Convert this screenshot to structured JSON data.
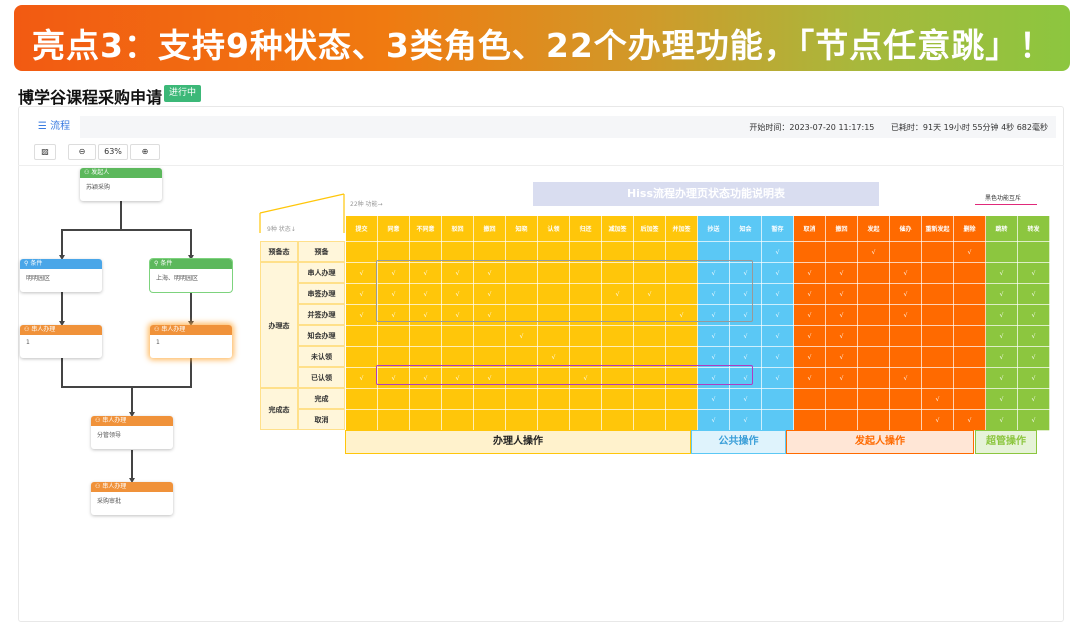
{
  "banner": {
    "text": "亮点3：支持9种状态、3类角色、22个办理功能，「节点任意跳」！"
  },
  "page": {
    "title": "博学谷课程采购申请",
    "status": "进行中"
  },
  "toolbar": {
    "tab": "流程",
    "start_label": "开始时间：",
    "start_value": "2023-07-20 11:17:15",
    "elapsed_label": "已耗时：",
    "elapsed_value": "91天 19小时 55分钟 4秒 682毫秒"
  },
  "zoom": {
    "value": "63%"
  },
  "nodes": [
    {
      "type": "发起人",
      "body": "苏颖采购",
      "color": "#5cb85c"
    },
    {
      "type": "条件",
      "body": "明明园区",
      "color": "#4aa6e8"
    },
    {
      "type": "条件",
      "body": "上海、明明园区",
      "color": "#5cb85c"
    },
    {
      "type": "串人办理",
      "body": "1",
      "color": "#f0923a"
    },
    {
      "type": "串人办理",
      "body": "1",
      "color": "#f0923a"
    },
    {
      "type": "串人办理",
      "body": "分管领导",
      "color": "#f0923a"
    },
    {
      "type": "串人办理",
      "body": "采购审批",
      "color": "#f0923a"
    }
  ],
  "matrix": {
    "title": "Hiss流程办理页状态功能说明表",
    "legend": "黑色功能互斥",
    "corner_top": "22种 功能→",
    "corner_bottom": "9种 状态↓",
    "columns": [
      "提交",
      "同意",
      "不同意",
      "驳回",
      "撤回",
      "知晓",
      "认领",
      "归还",
      "减加签",
      "后加签",
      "并加签",
      "抄送",
      "知会",
      "暂存",
      "取消",
      "撤回",
      "发起",
      "催办",
      "重新发起",
      "删除",
      "跳转",
      "转发"
    ],
    "groups": [
      {
        "label": "预备态",
        "rows": 1
      },
      {
        "label": "办理态",
        "rows": 6
      },
      {
        "label": "完成态",
        "rows": 2
      }
    ],
    "rows": [
      {
        "name": "预备",
        "checks": [
          13,
          16,
          19
        ]
      },
      {
        "name": "串人办理",
        "checks": [
          0,
          1,
          2,
          3,
          4,
          11,
          12,
          13,
          14,
          15,
          17,
          20,
          21
        ]
      },
      {
        "name": "串签办理",
        "checks": [
          0,
          1,
          2,
          3,
          4,
          8,
          9,
          11,
          12,
          13,
          14,
          15,
          17,
          20,
          21
        ]
      },
      {
        "name": "并签办理",
        "checks": [
          0,
          1,
          2,
          3,
          4,
          10,
          11,
          12,
          13,
          14,
          15,
          17,
          20,
          21
        ]
      },
      {
        "name": "知会办理",
        "checks": [
          5,
          11,
          12,
          13,
          14,
          15,
          20,
          21
        ]
      },
      {
        "name": "未认领",
        "checks": [
          6,
          11,
          12,
          13,
          14,
          15,
          20,
          21
        ]
      },
      {
        "name": "已认领",
        "checks": [
          0,
          1,
          2,
          3,
          4,
          7,
          11,
          12,
          13,
          14,
          15,
          17,
          20,
          21
        ]
      },
      {
        "name": "完成",
        "checks": [
          11,
          12,
          18,
          20,
          21
        ]
      },
      {
        "name": "取消",
        "checks": [
          11,
          12,
          18,
          19,
          20,
          21
        ]
      }
    ],
    "footer": [
      "办理人操作",
      "公共操作",
      "发起人操作",
      "超管操作"
    ],
    "colors": {
      "handler": "#ffc60a",
      "public": "#5bc8f5",
      "initiator": "#ff6a00",
      "admin": "#8cc63f"
    },
    "check": "√"
  }
}
